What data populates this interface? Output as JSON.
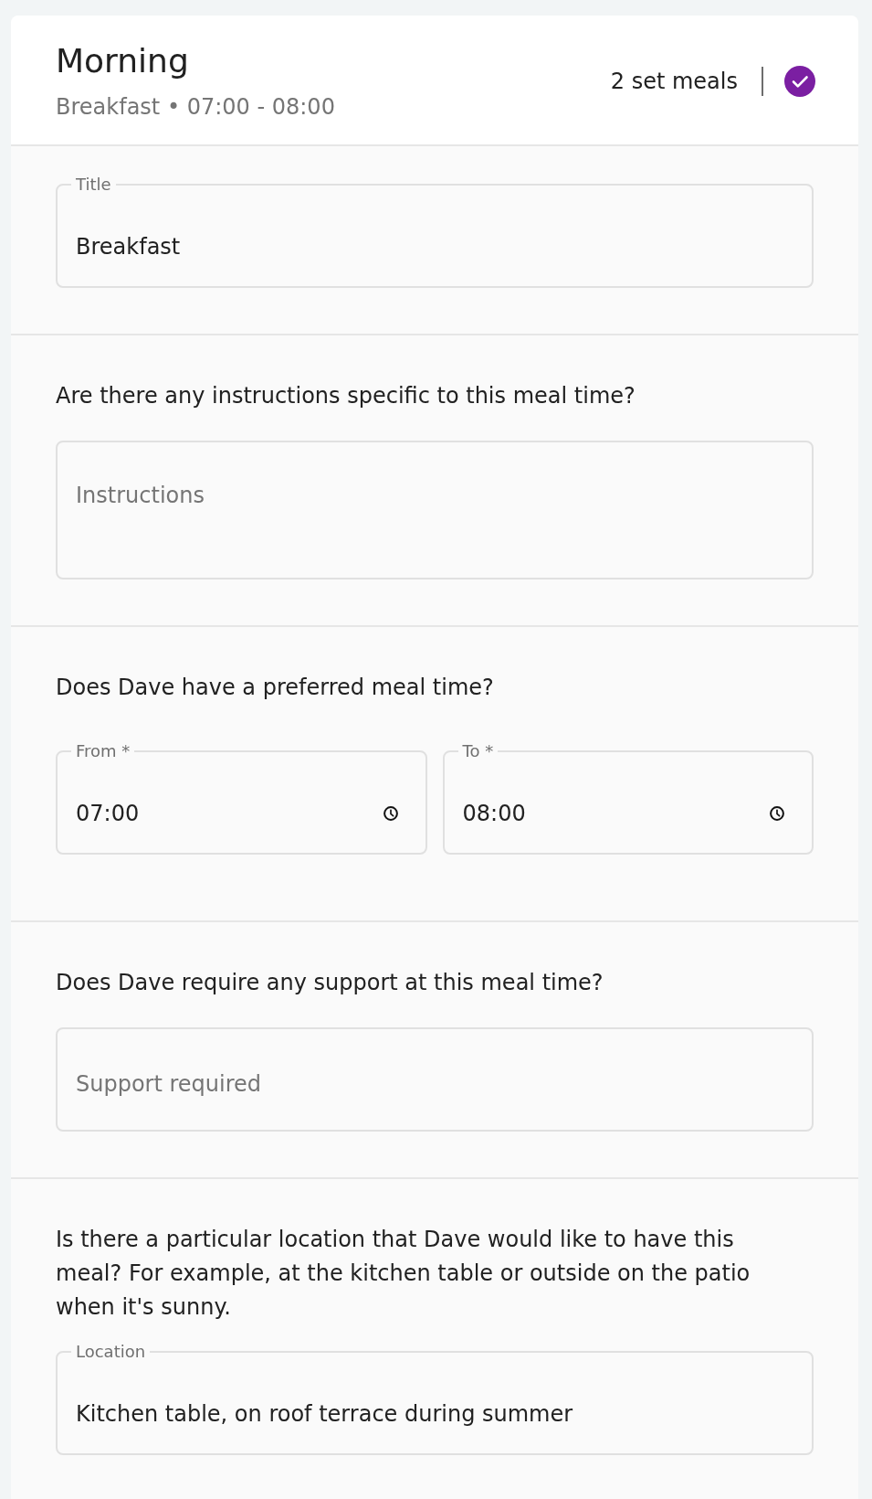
{
  "header": {
    "title": "Morning",
    "subtitle": "Breakfast • 07:00 - 08:00",
    "set_meals": "2 set meals",
    "completed": true
  },
  "sections": [
    {
      "fields": [
        {
          "kind": "text",
          "label": "Title",
          "value": "Breakfast"
        }
      ]
    },
    {
      "question": "Are there any instructions specific to this meal time?",
      "fields": [
        {
          "kind": "multiline",
          "placeholder": "Instructions"
        }
      ]
    },
    {
      "question": "Does Dave have a preferred meal time?",
      "fields": [
        {
          "kind": "time",
          "label": "From *",
          "value": "07:00"
        },
        {
          "kind": "time",
          "label": "To *",
          "value": "08:00"
        }
      ]
    },
    {
      "question": "Does Dave require any support at this meal time?",
      "fields": [
        {
          "kind": "text",
          "placeholder": "Support required"
        }
      ]
    },
    {
      "question": "Is there a particular location that Dave would like to have this meal? For example, at the kitchen table or outside on the patio when it's sunny.",
      "fields": [
        {
          "kind": "text",
          "label": "Location",
          "value": "Kitchen table, on roof terrace during summer"
        }
      ]
    }
  ]
}
